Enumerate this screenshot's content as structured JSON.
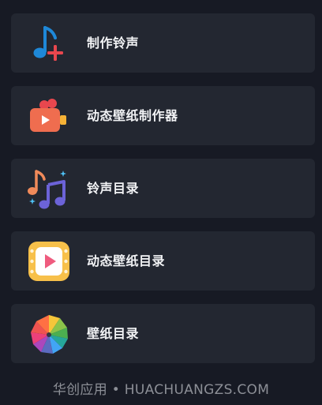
{
  "menu": {
    "items": [
      {
        "label": "制作铃声",
        "icon": "music-note-plus-icon"
      },
      {
        "label": "动态壁纸制作器",
        "icon": "video-camera-icon"
      },
      {
        "label": "铃声目录",
        "icon": "music-notes-icon"
      },
      {
        "label": "动态壁纸目录",
        "icon": "film-play-icon"
      },
      {
        "label": "壁纸目录",
        "icon": "color-wheel-icon"
      }
    ]
  },
  "footer": {
    "watermark": "华创应用 • HUACHUANGZS.COM"
  },
  "colors": {
    "background": "#171a24",
    "card": "#232731",
    "text": "#f2f3f5",
    "note_blue": "#1e88d8",
    "plus_red": "#e8474e",
    "camera_orange": "#ef6d4f",
    "lens_yellow": "#f5b236",
    "note_purple": "#6c63d8",
    "film_yellow": "#f7c04a",
    "play_pink": "#ef5b7e"
  }
}
